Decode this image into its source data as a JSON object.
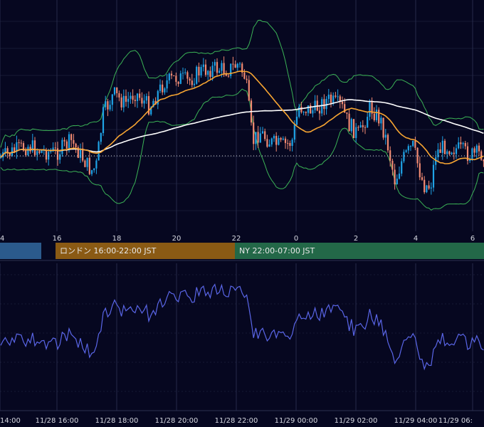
{
  "chart_data": {
    "type": "candlestick",
    "main_x_ticks": [
      "4",
      "16",
      "18",
      "20",
      "22",
      "0",
      "2",
      "4",
      "6"
    ],
    "sub_x_ticks": [
      "14:00",
      "11/28 16:00",
      "11/28 18:00",
      "11/28 20:00",
      "11/28 22:00",
      "11/29 00:00",
      "11/29 02:00",
      "11/29 04:00",
      "11/29 06:"
    ],
    "sessions": [
      {
        "label": "",
        "color": "#2b5a8c"
      },
      {
        "label": "ロンドン 16:00-22:00 JST",
        "color": "#8a5a14"
      },
      {
        "label": "NY 22:00-07:00 JST",
        "color": "#236848"
      }
    ],
    "colors": {
      "background": "#060720",
      "grid": "#262a4a",
      "up_candle": "#1fa3e6",
      "down_candle": "#f28a72",
      "ma_fast": "#f7a532",
      "ma_slow": "#ffffff",
      "bollinger": "#3bb356",
      "oscillator": "#5a66e8"
    },
    "grid": true,
    "indicators": [
      "candlestick",
      "moving-average-fast",
      "moving-average-slow",
      "bollinger-bands",
      "oscillator"
    ]
  }
}
